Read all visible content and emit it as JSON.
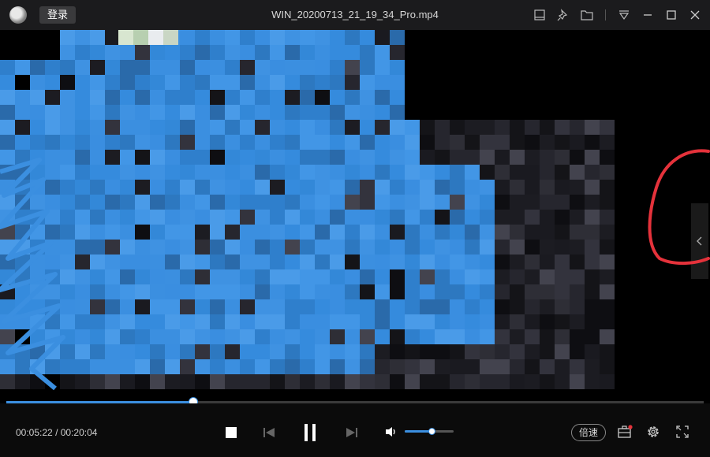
{
  "window": {
    "login_label": "登录",
    "file_name": "WIN_20200713_21_19_34_Pro.mp4"
  },
  "titlebar_icons": [
    "mini-mode-icon",
    "pin-icon",
    "folder-icon",
    "menu-dropdown-icon",
    "minimize-icon",
    "maximize-icon",
    "close-icon"
  ],
  "playback": {
    "current_time": "00:05:22",
    "separator": "/",
    "total_time": "00:20:04",
    "progress_fraction": 0.268,
    "volume_fraction": 0.55
  },
  "controls": {
    "speed_label": "倍速"
  },
  "colors": {
    "accent": "#3b8fe0",
    "annotation": "#e5323b",
    "notification_dot": "#e5323b"
  }
}
